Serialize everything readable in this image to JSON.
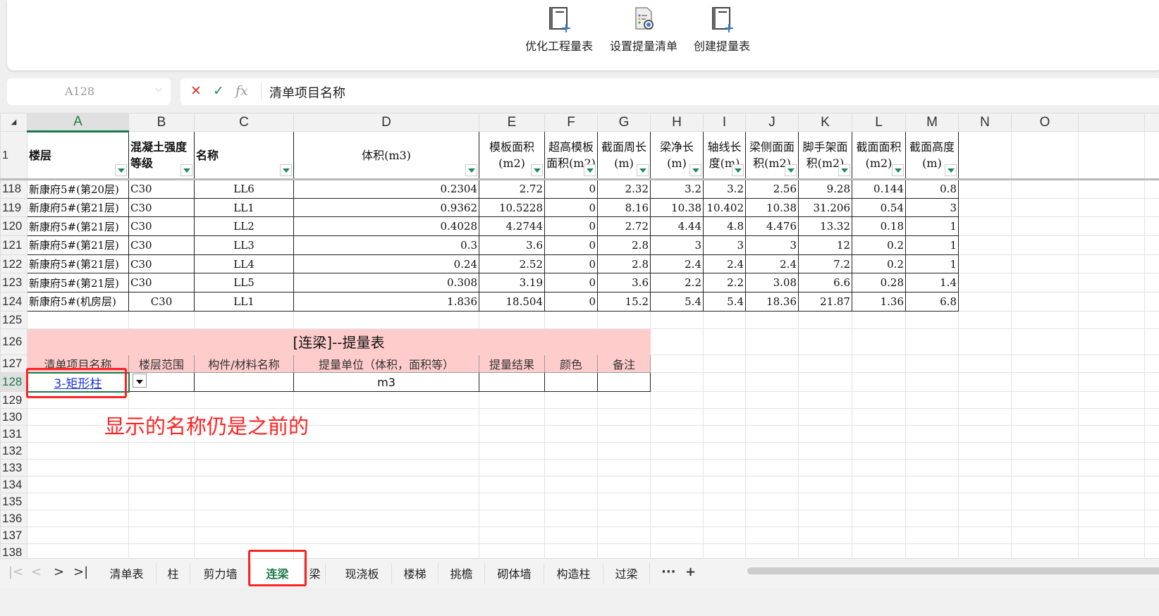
{
  "ribbon": {
    "buttons": [
      {
        "label": "优化工程量表",
        "icon": "table-add-icon"
      },
      {
        "label": "设置提量清单",
        "icon": "list-view-icon"
      },
      {
        "label": "创建提量表",
        "icon": "table-add-icon"
      }
    ]
  },
  "formula_bar": {
    "cell_ref": "A128",
    "cancel": "✕",
    "confirm": "✓",
    "fx": "fx",
    "value": "清单项目名称"
  },
  "columns": [
    "A",
    "B",
    "C",
    "D",
    "E",
    "F",
    "G",
    "H",
    "I",
    "J",
    "K",
    "L",
    "M",
    "N",
    "O"
  ],
  "header_row": {
    "row_num": "1",
    "cells": [
      "楼层",
      "混凝土强度等级",
      "名称",
      "体积(m3)",
      "模板面积(m2)",
      "超高模板面积(m2)",
      "截面周长(m)",
      "梁净长(m)",
      "轴线长度(m)",
      "梁侧面面积(m2)",
      "脚手架面积(m2)",
      "截面面积(m2)",
      "截面高度(m)"
    ]
  },
  "data_rows": [
    {
      "row": "118",
      "cells": [
        "新康府5#(第20层)",
        "C30",
        "LL6",
        "0.2304",
        "2.72",
        "0",
        "2.32",
        "3.2",
        "3.2",
        "2.56",
        "9.28",
        "0.144",
        "0.8"
      ]
    },
    {
      "row": "119",
      "cells": [
        "新康府5#(第21层)",
        "C30",
        "LL1",
        "0.9362",
        "10.5228",
        "0",
        "8.16",
        "10.38",
        "10.402",
        "10.38",
        "31.206",
        "0.54",
        "3"
      ]
    },
    {
      "row": "120",
      "cells": [
        "新康府5#(第21层)",
        "C30",
        "LL2",
        "0.4028",
        "4.2744",
        "0",
        "2.72",
        "4.44",
        "4.8",
        "4.476",
        "13.32",
        "0.18",
        "1"
      ]
    },
    {
      "row": "121",
      "cells": [
        "新康府5#(第21层)",
        "C30",
        "LL3",
        "0.3",
        "3.6",
        "0",
        "2.8",
        "3",
        "3",
        "3",
        "12",
        "0.2",
        "1"
      ]
    },
    {
      "row": "122",
      "cells": [
        "新康府5#(第21层)",
        "C30",
        "LL4",
        "0.24",
        "2.52",
        "0",
        "2.8",
        "2.4",
        "2.4",
        "2.4",
        "7.2",
        "0.2",
        "1"
      ]
    },
    {
      "row": "123",
      "cells": [
        "新康府5#(第21层)",
        "C30",
        "LL5",
        "0.308",
        "3.19",
        "0",
        "3.6",
        "2.2",
        "2.2",
        "3.08",
        "6.6",
        "0.28",
        "1.4"
      ]
    },
    {
      "row": "124",
      "cells": [
        "新康府5#(机房层)",
        "C30",
        "LL1",
        "1.836",
        "18.504",
        "0",
        "15.2",
        "5.4",
        "5.4",
        "18.36",
        "21.87",
        "1.36",
        "6.8"
      ]
    }
  ],
  "quantity_table": {
    "empty_row": "125",
    "title_row": "126",
    "title": "[连梁]--提量表",
    "header_row_num": "127",
    "headers": [
      "清单项目名称",
      "楼层范围",
      "构件/材料名称",
      "提量单位（体积，面积等）",
      "提量结果",
      "颜色",
      "备注"
    ],
    "entry_row_num": "128",
    "entry": {
      "name": "3-矩形柱",
      "unit": "m3"
    }
  },
  "empty_rows": [
    "129",
    "130",
    "131",
    "132",
    "133",
    "134",
    "135",
    "136",
    "137",
    "138"
  ],
  "annotation": "显示的名称仍是之前的",
  "sheet_tabs": {
    "nav": [
      "|<",
      "<",
      ">",
      ">|"
    ],
    "tabs": [
      "清单表",
      "柱",
      "剪力墙",
      "连梁",
      "梁",
      "现浇板",
      "楼梯",
      "挑檐",
      "砌体墙",
      "构造柱",
      "过梁"
    ],
    "active": "连梁",
    "more": "···",
    "add": "+"
  },
  "colors": {
    "accent": "#1a7a4a",
    "annotation": "#ff2222",
    "title_fill": "#ffcccc",
    "link": "#1a33dd"
  }
}
